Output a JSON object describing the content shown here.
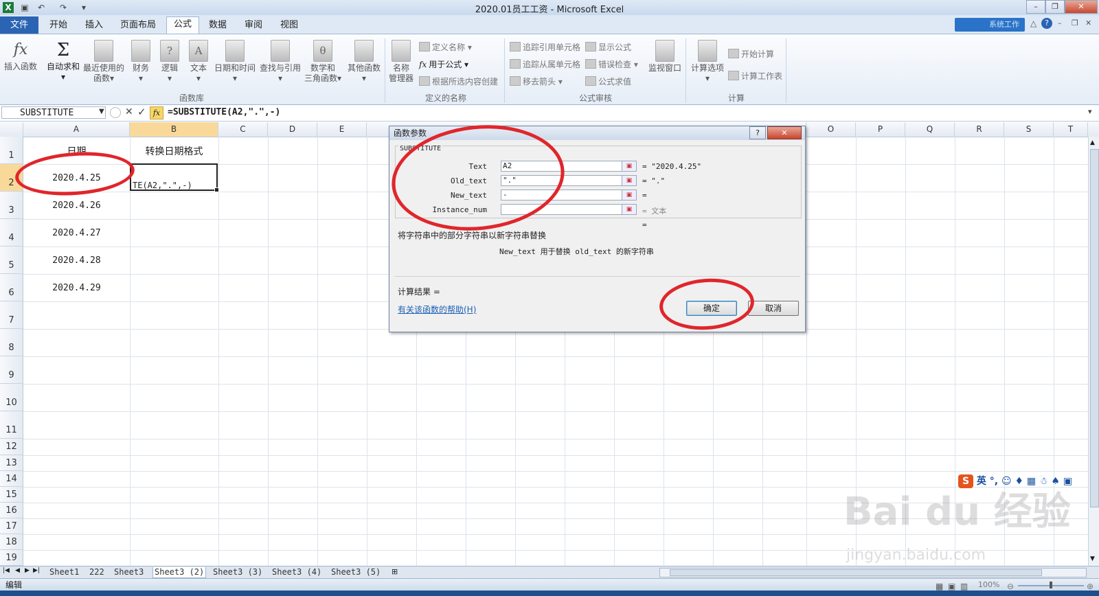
{
  "window": {
    "title": "2020.01员工工资 - Microsoft Excel",
    "cloud_label": "系统工作"
  },
  "tabs": [
    "文件",
    "开始",
    "插入",
    "页面布局",
    "公式",
    "数据",
    "审阅",
    "视图"
  ],
  "ribbon": {
    "insert_function": "插入函数",
    "autosum": "自动求和",
    "recent": "最近使用的",
    "recent2": "函数",
    "finance": "财务",
    "logic": "逻辑",
    "text": "文本",
    "datetime": "日期和时间",
    "lookup": "查找与引用",
    "math1": "数学和",
    "math2": "三角函数",
    "other": "其他函数",
    "group_library": "函数库",
    "name_mgr1": "名称",
    "name_mgr2": "管理器",
    "define_name": "定义名称",
    "use_formula": "用于公式",
    "create_sel": "根据所选内容创建",
    "group_names": "定义的名称",
    "trace_prec": "追踪引用单元格",
    "trace_dep": "追踪从属单元格",
    "remove_arrows": "移去箭头",
    "show_formulas": "显示公式",
    "error_check": "错误检查",
    "eval_formula": "公式求值",
    "group_audit": "公式审核",
    "watch": "监视窗口",
    "calc_opts": "计算选项",
    "calc_now": "开始计算",
    "calc_sheet": "计算工作表",
    "group_calc": "计算"
  },
  "formula_bar": {
    "name_box": "SUBSTITUTE",
    "fx": "fx",
    "formula": "=SUBSTITUTE(A2,\".\",-)"
  },
  "columns": [
    "A",
    "B",
    "C",
    "D",
    "E",
    "O",
    "P",
    "Q",
    "R",
    "S",
    "T"
  ],
  "rows": [
    "1",
    "2",
    "3",
    "4",
    "5",
    "6",
    "7",
    "8",
    "9",
    "10",
    "11",
    "12",
    "13",
    "14",
    "15",
    "16",
    "17",
    "18",
    "19"
  ],
  "cells": {
    "A1": "日期",
    "B1": "转换日期格式",
    "A2": "2020.4.25",
    "B2": "TE(A2,\".\",-)",
    "A3": "2020.4.26",
    "A4": "2020.4.27",
    "A5": "2020.4.28",
    "A6": "2020.4.29"
  },
  "dialog": {
    "title": "函数参数",
    "func_name": "SUBSTITUTE",
    "args": [
      {
        "label": "Text",
        "value": "A2",
        "result": "= \"2020.4.25\""
      },
      {
        "label": "Old_text",
        "value": "\".\"",
        "result": "= \".\""
      },
      {
        "label": "New_text",
        "value": "-",
        "result": "="
      },
      {
        "label": "Instance_num",
        "value": "",
        "result": "= 文本"
      }
    ],
    "eq_line": "=",
    "description": "将字符串中的部分字符串以新字符串替换",
    "arg_desc": "New_text  用于替换 old_text 的新字符串",
    "calc_result": "计算结果 =",
    "help_link": "有关该函数的帮助(H)",
    "ok": "确定",
    "cancel": "取消",
    "help_btn": "?",
    "close_btn": "✕"
  },
  "sheets": [
    "Sheet1",
    "222",
    "Sheet3",
    "Sheet3 (2)",
    "Sheet3 (3)",
    "Sheet3 (4)",
    "Sheet3 (5)"
  ],
  "active_sheet": "Sheet3 (2)",
  "status": {
    "mode": "编辑",
    "zoom": "100%"
  },
  "ime": "英",
  "watermark": "Bai du 经验",
  "watermark_url": "jingyan.baidu.com"
}
